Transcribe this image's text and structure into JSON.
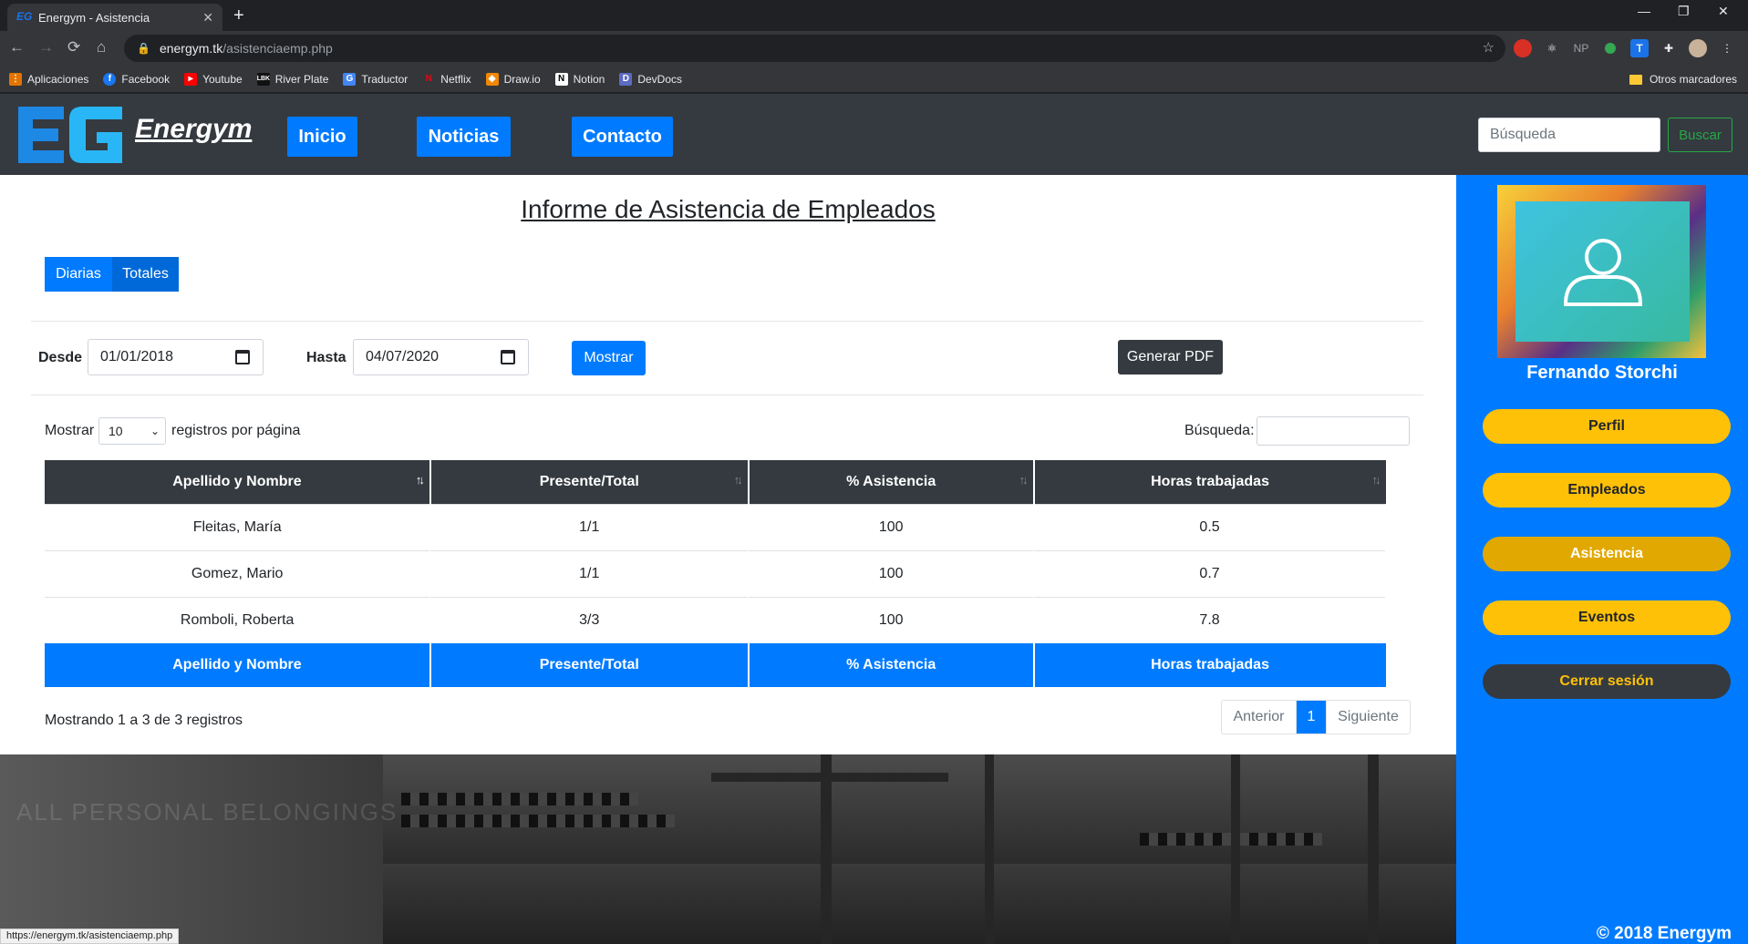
{
  "browser": {
    "tab_title": "Energym - Asistencia",
    "url_host": "energym.tk",
    "url_path": "/asistenciaemp.php",
    "status_url": "https://energym.tk/asistenciaemp.php",
    "bookmarks": [
      "Aplicaciones",
      "Facebook",
      "Youtube",
      "River Plate",
      "Traductor",
      "Netflix",
      "Draw.io",
      "Notion",
      "DevDocs"
    ],
    "other_bookmarks": "Otros marcadores"
  },
  "nav": {
    "brand": "Energym",
    "links": [
      "Inicio",
      "Noticias",
      "Contacto"
    ],
    "search_placeholder": "Búsqueda",
    "search_button": "Buscar"
  },
  "report": {
    "title": "Informe de Asistencia de Empleados",
    "tabs": [
      "Diarias",
      "Totales"
    ],
    "desde_label": "Desde",
    "desde_value": "01/01/2018",
    "hasta_label": "Hasta",
    "hasta_value": "04/07/2020",
    "show_button": "Mostrar",
    "pdf_button": "Generar PDF",
    "length_prefix": "Mostrar",
    "length_value": "10",
    "length_suffix": "registros por página",
    "filter_label": "Búsqueda:",
    "columns": [
      "Apellido y Nombre",
      "Presente/Total",
      "% Asistencia",
      "Horas trabajadas"
    ],
    "rows": [
      [
        "Fleitas, María",
        "1/1",
        "100",
        "0.5"
      ],
      [
        "Gomez, Mario",
        "1/1",
        "100",
        "0.7"
      ],
      [
        "Romboli, Roberta",
        "3/3",
        "100",
        "7.8"
      ]
    ],
    "info": "Mostrando 1 a 3 de 3 registros",
    "pager": [
      "Anterior",
      "1",
      "Siguiente"
    ]
  },
  "sidebar": {
    "user_name": "Fernando Storchi",
    "buttons": [
      "Perfil",
      "Empleados",
      "Asistencia",
      "Eventos",
      "Cerrar sesión"
    ],
    "copyright": "© 2018 Energym"
  },
  "colors": {
    "primary": "#007bff",
    "dark": "#343a40",
    "warning": "#ffc107",
    "success": "#28a745"
  }
}
